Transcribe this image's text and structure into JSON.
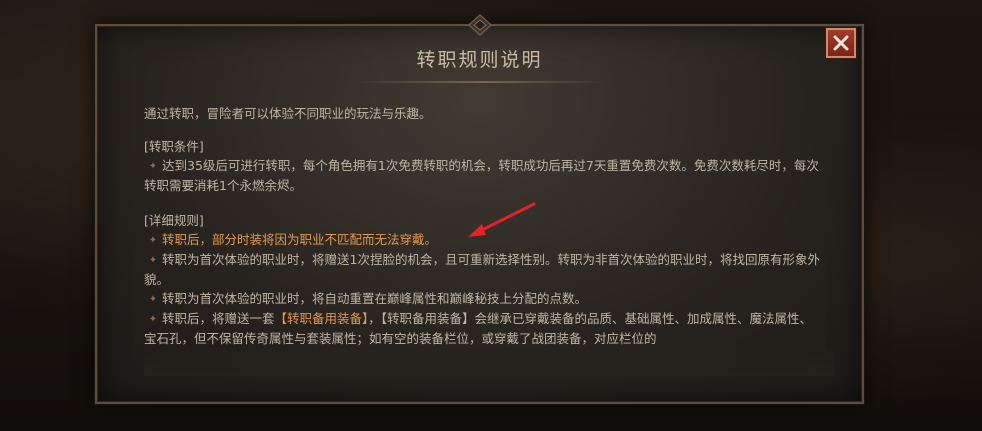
{
  "dialog": {
    "title": "转职规则说明",
    "intro": "通过转职，冒险者可以体验不同职业的玩法与乐趣。",
    "section1": {
      "title": "[转职条件]",
      "items": [
        "达到35级后可进行转职，每个角色拥有1次免费转职的机会，转职成功后再过7天重置免费次数。免费次数耗尽时，每次转职需要消耗1个永燃余烬。"
      ]
    },
    "section2": {
      "title": "[详细规则]",
      "items": [
        "转职后，部分时装将因为职业不匹配而无法穿戴。",
        "转职为首次体验的职业时，将赠送1次捏脸的机会，且可重新选择性别。转职为非首次体验的职业时，将找回原有形象外貌。",
        "转职为首次体验的职业时，将自动重置在巅峰属性和巅峰秘技上分配的点数。",
        "转职后，将赠送一套",
        "【转职备用装备】",
        "，【转职备用装备】会继承已穿戴装备的品质、基础属性、加成属性、魔法属性、宝石孔，但不保留传奇属性与套装属性；如有空的装备栏位，或穿戴了战团装备，对应栏位的"
      ]
    },
    "close_icon": "close-icon",
    "colors": {
      "highlight": "#e39a4c",
      "text": "#bfb5a6",
      "close": "#a33a2a",
      "arrow": "#e8202a"
    }
  }
}
